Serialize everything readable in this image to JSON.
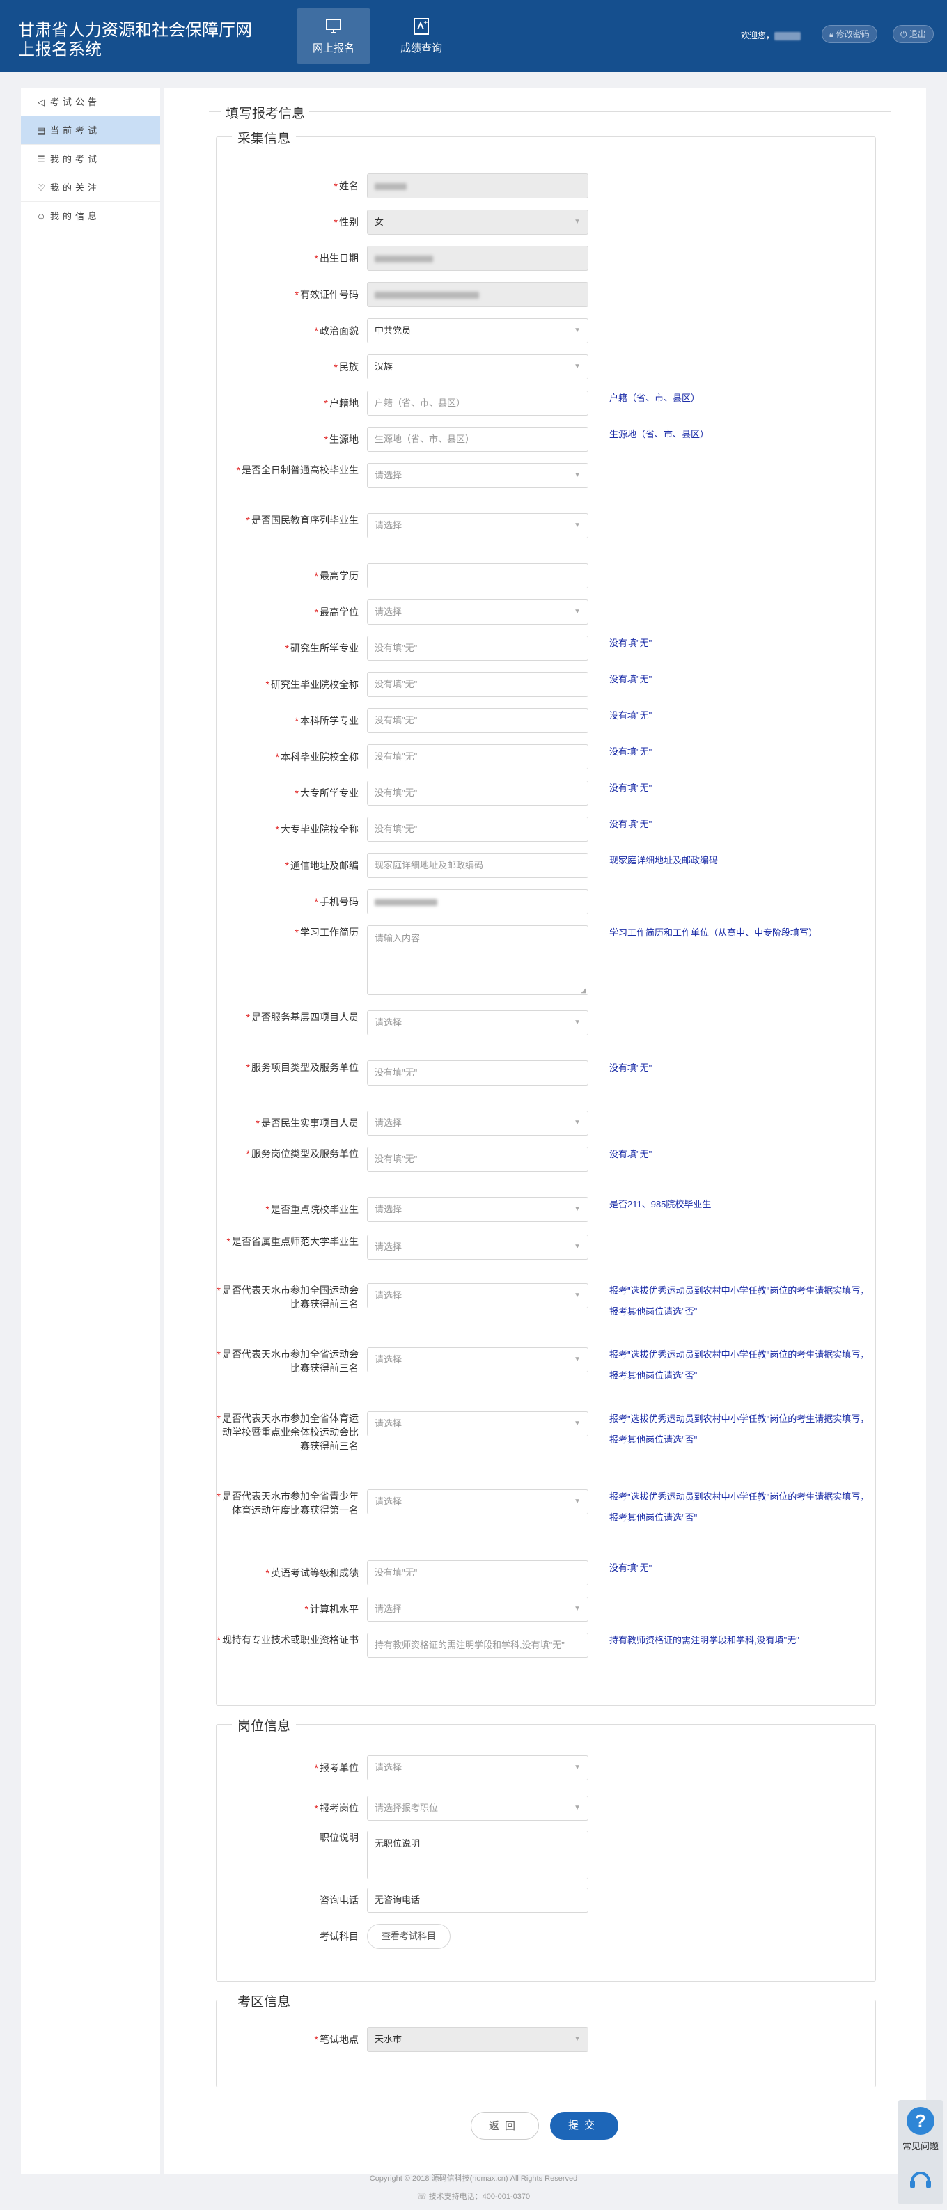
{
  "header": {
    "title_line1": "甘肃省人力资源和社会保障厅网",
    "title_line2": "上报名系统",
    "nav": [
      {
        "label": "网上报名",
        "icon": "monitor-icon"
      },
      {
        "label": "成绩查询",
        "icon": "score-icon"
      }
    ],
    "welcome_label": "欢迎您，",
    "change_password": "修改密码",
    "logout": "退出"
  },
  "sidebar": {
    "items": [
      {
        "label": "考试公告",
        "icon": "megaphone-icon"
      },
      {
        "label": "当前考试",
        "icon": "document-icon"
      },
      {
        "label": "我的考试",
        "icon": "list-icon"
      },
      {
        "label": "我的关注",
        "icon": "heart-icon"
      },
      {
        "label": "我的信息",
        "icon": "user-icon"
      }
    ]
  },
  "main": {
    "heading": "填写报考信息",
    "collect": {
      "title": "采集信息",
      "fields": [
        {
          "label": "姓名",
          "kind": "disabled-blur",
          "value": "",
          "placeholder": "",
          "hint": ""
        },
        {
          "label": "性别",
          "kind": "select-disabled",
          "value": "女",
          "placeholder": "",
          "hint": ""
        },
        {
          "label": "出生日期",
          "kind": "disabled-blur",
          "value": "",
          "placeholder": "",
          "hint": ""
        },
        {
          "label": "有效证件号码",
          "kind": "disabled-blur",
          "value": "",
          "placeholder": "",
          "hint": ""
        },
        {
          "label": "政治面貌",
          "kind": "select",
          "value": "中共党员",
          "placeholder": "",
          "hint": ""
        },
        {
          "label": "民族",
          "kind": "select",
          "value": "汉族",
          "placeholder": "",
          "hint": ""
        },
        {
          "label": "户籍地",
          "kind": "input",
          "value": "",
          "placeholder": "户籍（省、市、县区）",
          "hint": "户籍（省、市、县区）"
        },
        {
          "label": "生源地",
          "kind": "input",
          "value": "",
          "placeholder": "生源地（省、市、县区）",
          "hint": "生源地（省、市、县区）"
        },
        {
          "label": "是否全日制普通高校毕业生",
          "kind": "select",
          "value": "",
          "placeholder": "请选择",
          "hint": ""
        },
        {
          "label": "是否国民教育序列毕业生",
          "kind": "select",
          "value": "",
          "placeholder": "请选择",
          "hint": ""
        },
        {
          "label": "最高学历",
          "kind": "input",
          "value": "",
          "placeholder": "",
          "hint": ""
        },
        {
          "label": "最高学位",
          "kind": "select",
          "value": "",
          "placeholder": "请选择",
          "hint": ""
        },
        {
          "label": "研究生所学专业",
          "kind": "input",
          "value": "",
          "placeholder": "没有填\"无\"",
          "hint": "没有填\"无\""
        },
        {
          "label": "研究生毕业院校全称",
          "kind": "input",
          "value": "",
          "placeholder": "没有填\"无\"",
          "hint": "没有填\"无\""
        },
        {
          "label": "本科所学专业",
          "kind": "input",
          "value": "",
          "placeholder": "没有填\"无\"",
          "hint": "没有填\"无\""
        },
        {
          "label": "本科毕业院校全称",
          "kind": "input",
          "value": "",
          "placeholder": "没有填\"无\"",
          "hint": "没有填\"无\""
        },
        {
          "label": "大专所学专业",
          "kind": "input",
          "value": "",
          "placeholder": "没有填\"无\"",
          "hint": "没有填\"无\""
        },
        {
          "label": "大专毕业院校全称",
          "kind": "input",
          "value": "",
          "placeholder": "没有填\"无\"",
          "hint": "没有填\"无\""
        },
        {
          "label": "通信地址及邮编",
          "kind": "input",
          "value": "",
          "placeholder": "现家庭详细地址及邮政编码",
          "hint": "现家庭详细地址及邮政编码"
        },
        {
          "label": "手机号码",
          "kind": "input-blur",
          "value": "",
          "placeholder": "",
          "hint": ""
        },
        {
          "label": "学习工作简历",
          "kind": "textarea",
          "value": "",
          "placeholder": "请输入内容",
          "hint": "学习工作简历和工作单位（从高中、中专阶段填写）"
        },
        {
          "label": "是否服务基层四项目人员",
          "kind": "select",
          "value": "",
          "placeholder": "请选择",
          "hint": ""
        },
        {
          "label": "服务项目类型及服务单位",
          "kind": "input",
          "value": "",
          "placeholder": "没有填\"无\"",
          "hint": "没有填\"无\""
        },
        {
          "label": "是否民生实事项目人员",
          "kind": "select",
          "value": "",
          "placeholder": "请选择",
          "hint": ""
        },
        {
          "label": "服务岗位类型及服务单位",
          "kind": "input",
          "value": "",
          "placeholder": "没有填\"无\"",
          "hint": "没有填\"无\""
        },
        {
          "label": "是否重点院校毕业生",
          "kind": "select",
          "value": "",
          "placeholder": "请选择",
          "hint": "是否211、985院校毕业生"
        },
        {
          "label": "是否省属重点师范大学毕业生",
          "kind": "select",
          "value": "",
          "placeholder": "请选择",
          "hint": ""
        },
        {
          "label": "是否代表天水市参加全国运动会比赛获得前三名",
          "kind": "select",
          "value": "",
          "placeholder": "请选择",
          "hint": "报考\"选拔优秀运动员到农村中小学任教\"岗位的考生请据实填写，报考其他岗位请选\"否\""
        },
        {
          "label": "是否代表天水市参加全省运动会比赛获得前三名",
          "kind": "select",
          "value": "",
          "placeholder": "请选择",
          "hint": "报考\"选拔优秀运动员到农村中小学任教\"岗位的考生请据实填写，报考其他岗位请选\"否\""
        },
        {
          "label": "是否代表天水市参加全省体育运动学校暨重点业余体校运动会比赛获得前三名",
          "kind": "select",
          "value": "",
          "placeholder": "请选择",
          "hint": "报考\"选拔优秀运动员到农村中小学任教\"岗位的考生请据实填写，报考其他岗位请选\"否\""
        },
        {
          "label": "是否代表天水市参加全省青少年体育运动年度比赛获得第一名",
          "kind": "select",
          "value": "",
          "placeholder": "请选择",
          "hint": "报考\"选拔优秀运动员到农村中小学任教\"岗位的考生请据实填写，报考其他岗位请选\"否\""
        },
        {
          "label": "英语考试等级和成绩",
          "kind": "input",
          "value": "",
          "placeholder": "没有填\"无\"",
          "hint": "没有填\"无\""
        },
        {
          "label": "计算机水平",
          "kind": "select",
          "value": "",
          "placeholder": "请选择",
          "hint": ""
        },
        {
          "label": "现持有专业技术或职业资格证书",
          "kind": "input",
          "value": "",
          "placeholder": "持有教师资格证的需注明学段和学科,没有填\"无\"",
          "hint": "持有教师资格证的需注明学段和学科,没有填\"无\""
        }
      ]
    },
    "post": {
      "title": "岗位信息",
      "fields": [
        {
          "label": "报考单位",
          "kind": "select",
          "value": "",
          "placeholder": "请选择",
          "hint": ""
        },
        {
          "label": "报考岗位",
          "kind": "select",
          "value": "",
          "placeholder": "请选择报考职位",
          "hint": ""
        },
        {
          "label": "职位说明",
          "kind": "static-box",
          "value": "无职位说明",
          "placeholder": "",
          "hint": ""
        },
        {
          "label": "咨询电话",
          "kind": "static",
          "value": "无咨询电话",
          "placeholder": "",
          "hint": ""
        },
        {
          "label": "考试科目",
          "kind": "button",
          "value": "查看考试科目",
          "placeholder": "",
          "hint": ""
        }
      ]
    },
    "exam": {
      "title": "考区信息",
      "fields": [
        {
          "label": "笔试地点",
          "kind": "select-disabled",
          "value": "天水市",
          "placeholder": "",
          "hint": ""
        }
      ]
    },
    "back_label": "返回",
    "submit_label": "提交"
  },
  "footer": {
    "copyright": "Copyright © 2018 源码信科技(nomax.cn) All Rights Reserved",
    "support": "技术支持电话：400-001-0370"
  },
  "faq": {
    "label": "常见问题"
  }
}
